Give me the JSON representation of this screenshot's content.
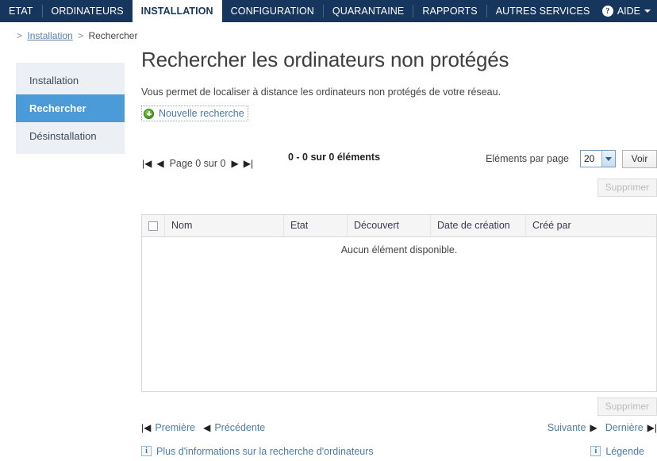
{
  "topnav": {
    "items": [
      {
        "label": "ETAT",
        "active": false
      },
      {
        "label": "ORDINATEURS",
        "active": false
      },
      {
        "label": "INSTALLATION",
        "active": true
      },
      {
        "label": "CONFIGURATION",
        "active": false
      },
      {
        "label": "QUARANTAINE",
        "active": false
      },
      {
        "label": "RAPPORTS",
        "active": false
      },
      {
        "label": "AUTRES SERVICES",
        "active": false
      }
    ],
    "help_icon": "question-mark-icon",
    "help_glyph": "?",
    "help_label": "AIDE",
    "caret_icon": "chevron-down-icon",
    "bg_color": "#17365d"
  },
  "breadcrumb": {
    "lead": ">",
    "link": "Installation",
    "separator": ">",
    "current": "Rechercher"
  },
  "sidebar": {
    "items": [
      {
        "label": "Installation",
        "active": false
      },
      {
        "label": "Rechercher",
        "active": true
      },
      {
        "label": "Désinstallation",
        "active": false
      }
    ],
    "active_color": "#4a9bd8",
    "bg_color": "#eceff3"
  },
  "main": {
    "title": "Rechercher les ordinateurs non protégés",
    "description": "Vous permet de localiser à distance les ordinateurs non protégés de votre réseau.",
    "new_search": {
      "icon": "plus-circle-icon",
      "label": "Nouvelle recherche",
      "icon_color": "#3f9c18"
    }
  },
  "toolbar": {
    "pager": {
      "first_icon": "first-page-icon",
      "first_glyph": "|◀",
      "prev_icon": "previous-page-icon",
      "prev_glyph": "◀",
      "page_label": "Page 0 sur 0",
      "next_icon": "next-page-icon",
      "next_glyph": "▶",
      "last_icon": "last-page-icon",
      "last_glyph": "▶|"
    },
    "count_label": "0 - 0 sur 0 éléments",
    "per_page_label": "Eléments par page",
    "per_page_value": "20",
    "per_page_options": [
      "20"
    ],
    "view_button": "Voir",
    "delete_button": "Supprimer"
  },
  "table": {
    "select_all_icon": "checkbox-icon",
    "columns": [
      "Nom",
      "Etat",
      "Découvert",
      "Date de création",
      "Créé par"
    ],
    "empty_message": "Aucun élément disponible.",
    "rows": []
  },
  "bottom": {
    "delete_button": "Supprimer",
    "first_icon": "first-page-icon",
    "first_glyph": "|◀",
    "first_label": "Première",
    "prev_icon": "previous-page-icon",
    "prev_glyph": "◀",
    "prev_label": "Précédente",
    "next_label": "Suivante",
    "next_icon": "next-page-icon",
    "next_glyph": "▶",
    "last_label": "Dernière",
    "last_icon": "last-page-icon",
    "last_glyph": "▶|"
  },
  "footer": {
    "more_info": {
      "icon": "info-icon",
      "glyph": "i",
      "label": "Plus d'informations sur la recherche d'ordinateurs"
    },
    "legend": {
      "icon": "info-icon",
      "glyph": "i",
      "label": "Légende"
    }
  }
}
